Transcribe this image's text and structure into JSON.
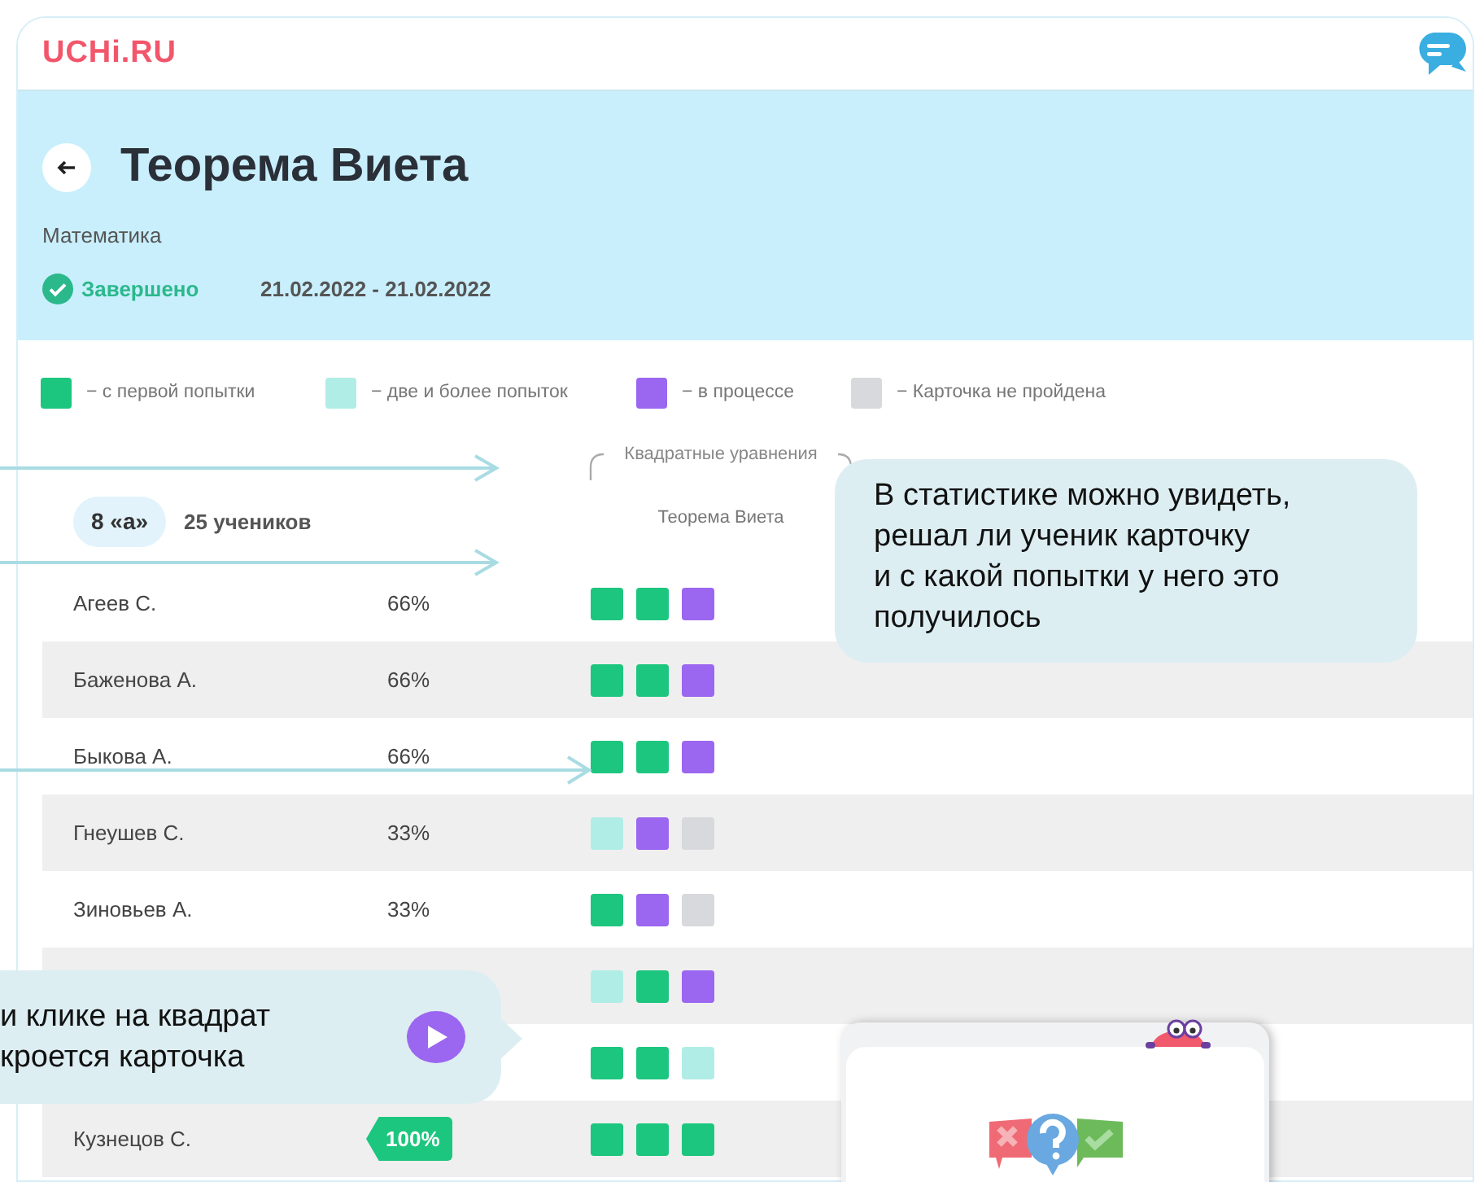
{
  "header": {
    "logo": "UCHi.RU"
  },
  "assignment": {
    "title": "Теорема Виета",
    "subject": "Математика",
    "status": {
      "label": "Завершено",
      "completed": true
    },
    "dates": "21.02.2022 - 21.02.2022"
  },
  "legend": [
    {
      "label": "− с первой попытки",
      "color": "#1dc67e"
    },
    {
      "label": "− две и более попыток",
      "color": "#b0ede6"
    },
    {
      "label": "− в процессе",
      "color": "#9b66f0"
    },
    {
      "label": "− Карточка не пройдена",
      "color": "#d8d9dc"
    }
  ],
  "class": {
    "name": "8 «а»",
    "count": "25 учеников"
  },
  "columns": {
    "group": "Квадратные уравнения",
    "topic": "Теорема Виета"
  },
  "students": [
    {
      "name": "Агеев С.",
      "score": "66%",
      "highlight": false,
      "cells": [
        {
          "color": "#1dc67e"
        },
        {
          "color": "#1dc67e"
        },
        {
          "color": "#9b66f0"
        }
      ]
    },
    {
      "name": "Баженова А.",
      "score": "66%",
      "highlight": false,
      "cells": [
        {
          "color": "#1dc67e"
        },
        {
          "color": "#1dc67e"
        },
        {
          "color": "#9b66f0"
        }
      ]
    },
    {
      "name": "Быкова А.",
      "score": "66%",
      "highlight": false,
      "cells": [
        {
          "color": "#1dc67e"
        },
        {
          "color": "#1dc67e"
        },
        {
          "color": "#9b66f0"
        }
      ]
    },
    {
      "name": "Гнеушев С.",
      "score": "33%",
      "highlight": false,
      "cells": [
        {
          "color": "#b0ede6"
        },
        {
          "color": "#9b66f0"
        },
        {
          "color": "#d8d9dc"
        }
      ]
    },
    {
      "name": "Зиновьев А.",
      "score": "33%",
      "highlight": false,
      "cells": [
        {
          "color": "#1dc67e"
        },
        {
          "color": "#9b66f0"
        },
        {
          "color": "#d8d9dc"
        }
      ]
    },
    {
      "cells": [
        {
          "color": "#b0ede6"
        },
        {
          "color": "#1dc67e"
        },
        {
          "color": "#9b66f0"
        }
      ]
    },
    {
      "cells": [
        {
          "color": "#1dc67e"
        },
        {
          "color": "#1dc67e"
        },
        {
          "color": "#b0ede6"
        }
      ]
    },
    {
      "name": "Кузнецов С.",
      "score": "100%",
      "highlight": true,
      "cells": [
        {
          "color": "#1dc67e"
        },
        {
          "color": "#1dc67e"
        },
        {
          "color": "#1dc67e"
        }
      ]
    }
  ],
  "callouts": [
    {
      "text": "В статистике можно увидеть,\nрешал ли ученик карточку\nи с какой попытки у него это\nполучилось"
    },
    {
      "text": "и клике на квадрат\nкроется карточка"
    }
  ]
}
